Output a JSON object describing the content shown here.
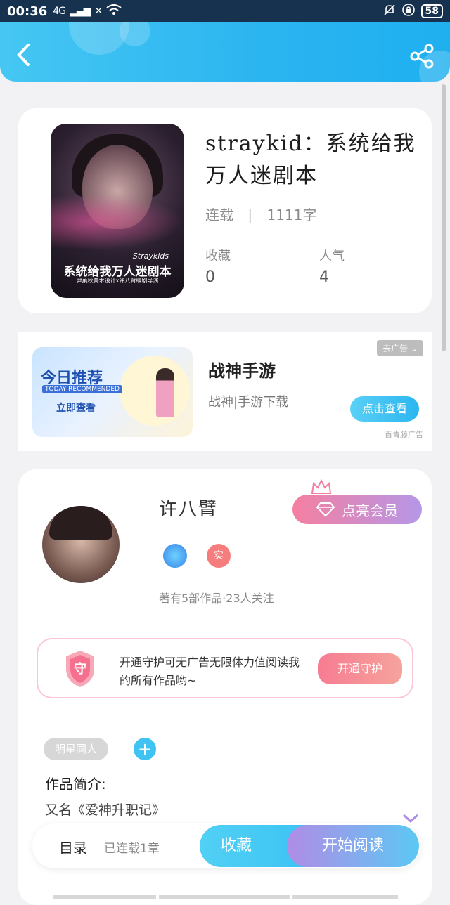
{
  "status_bar": {
    "time": "00:36",
    "signal_1": "4G",
    "signal_2": "✕",
    "battery": "58"
  },
  "book": {
    "title": "straykid：系统给我万人迷剧本",
    "cover_caption": "系统给我万人迷剧本",
    "cover_brand": "Straykids",
    "cover_credit": "尹菓秋美术设计x许八臂编剧导演",
    "status": "连载",
    "word_count": "1111字",
    "favorites_label": "收藏",
    "favorites_value": "0",
    "popularity_label": "人气",
    "popularity_value": "4"
  },
  "ad": {
    "banner_title": "今日推荐",
    "banner_sub": "TODAY RECOMMENDED",
    "banner_cta": "立即查看",
    "title": "战神手游",
    "desc": "战神|手游下载",
    "close_label": "去广告",
    "button_label": "点击查看",
    "source": "百青藤广告"
  },
  "author": {
    "name": "许八臂",
    "vip_button": "点亮会员",
    "badge_real": "实",
    "works": "著有5部作品·23人关注",
    "guard_text": "开通守护可无广告无限体力值阅读我的所有作品哟~",
    "guard_button": "开通守护",
    "shield_char": "守",
    "tag": "明星同人",
    "add_tag": "+",
    "intro_label": "作品简介:",
    "intro_line1": "又名《爱神升职记》"
  },
  "bottom_bar": {
    "toc_label": "目录",
    "toc_count": "已连载1章",
    "fav_button": "收藏",
    "read_button": "开始阅读"
  },
  "colors": {
    "accent": "#2ab4f0",
    "pink": "#f57fa0",
    "purple": "#b08ce6"
  }
}
